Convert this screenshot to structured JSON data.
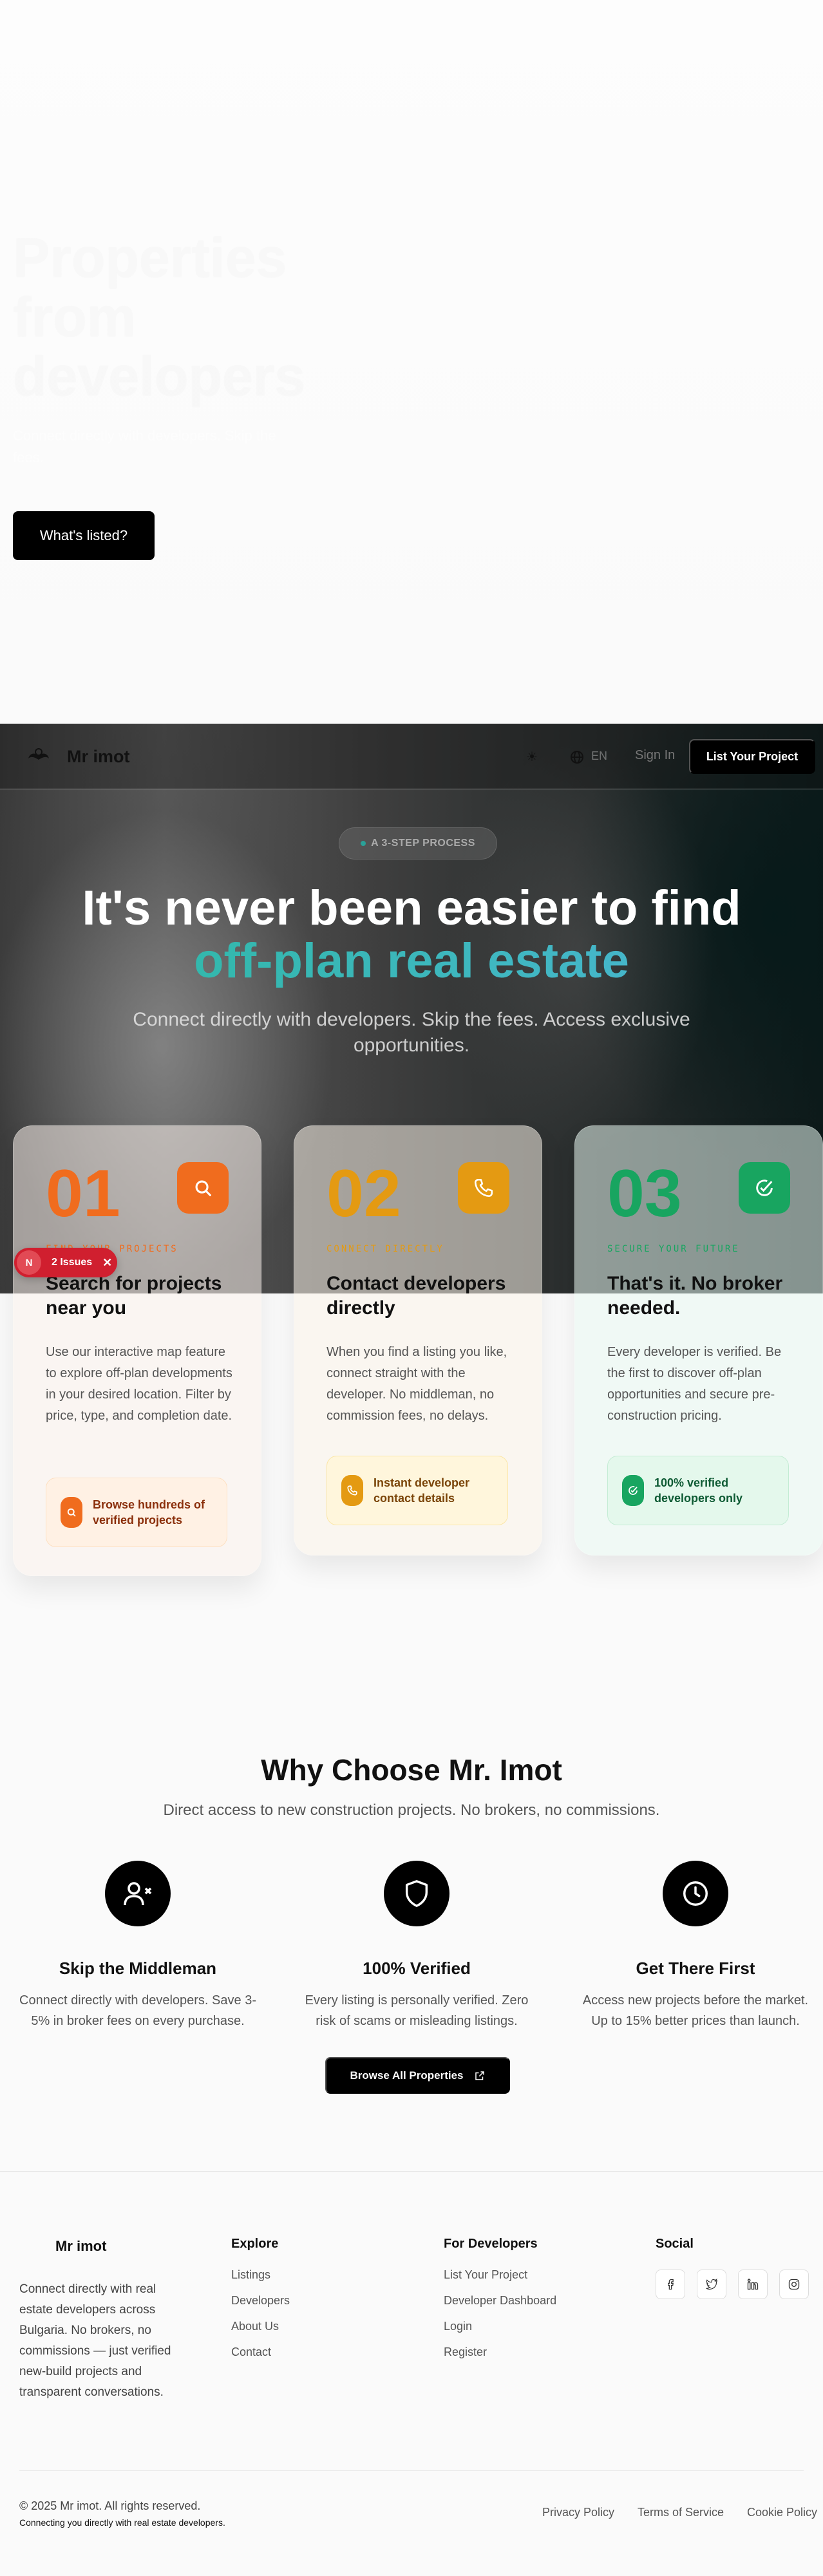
{
  "hero": {
    "title": "Properties from developers",
    "subtitle": "Connect directly with developers. Skip the fees.",
    "cta": "What's listed?"
  },
  "nav": {
    "logo": "Mr imot",
    "lang": "EN",
    "sign_in": "Sign In",
    "list_project": "List Your Project"
  },
  "process": {
    "pill": "A 3-STEP PROCESS",
    "title_line1": "It's never been easier to find",
    "title_line2": "off-plan real estate",
    "lead": "Connect directly with developers. Skip the fees. Access exclusive opportunities."
  },
  "steps": [
    {
      "number": "01",
      "kicker": "FIND YOUR PROJECTS",
      "title": "Search for projects near you",
      "body": "Use our interactive map feature to explore off-plan developments in your desired location. Filter by price, type, and completion date.",
      "feature": "Browse hundreds of verified projects",
      "icon": "search-icon",
      "color": "#f06c1e"
    },
    {
      "number": "02",
      "kicker": "CONNECT DIRECTLY",
      "title": "Contact developers directly",
      "body": "When you find a listing you like, connect straight with the developer. No middleman, no commission fees, no delays.",
      "feature": "Instant developer contact details",
      "icon": "phone-icon",
      "color": "#e49a12"
    },
    {
      "number": "03",
      "kicker": "SECURE YOUR FUTURE",
      "title": "That's it. No broker needed.",
      "body": "Every developer is verified. Be the first to discover off-plan opportunities and secure pre-construction pricing.",
      "feature": "100% verified developers only",
      "icon": "check-circle-icon",
      "color": "#18a560"
    }
  ],
  "issues_badge": {
    "label": "2 Issues",
    "logo": "N"
  },
  "why": {
    "title": "Why Choose Mr. Imot",
    "subtitle": "Direct access to new construction projects. No brokers, no commissions.",
    "features": [
      {
        "title": "Skip the Middleman",
        "text": "Connect directly with developers. Save 3-5% in broker fees on every purchase.",
        "icon": "user-x-icon"
      },
      {
        "title": "100% Verified",
        "text": "Every listing is personally verified. Zero risk of scams or misleading listings.",
        "icon": "shield-icon"
      },
      {
        "title": "Get There First",
        "text": "Access new projects before the market. Up to 15% better prices than launch.",
        "icon": "clock-icon"
      }
    ],
    "browse": "Browse All Properties"
  },
  "footer": {
    "brand": "Mr imot",
    "description": "Connect directly with real estate developers across Bulgaria. No brokers, no commissions — just verified new-build projects and transparent conversations.",
    "explore_heading": "Explore",
    "explore": [
      "Listings",
      "Developers",
      "About Us",
      "Contact"
    ],
    "developers_heading": "For Developers",
    "developers": [
      "List Your Project",
      "Developer Dashboard",
      "Login",
      "Register"
    ],
    "social_heading": "Social",
    "social": [
      "facebook-icon",
      "twitter-icon",
      "linkedin-icon",
      "instagram-icon"
    ],
    "copyright": "© 2025 Mr imot. All rights reserved.",
    "tagline": "Connecting you directly with real estate developers.",
    "legal": [
      "Privacy Policy",
      "Terms of Service",
      "Cookie Policy"
    ]
  }
}
